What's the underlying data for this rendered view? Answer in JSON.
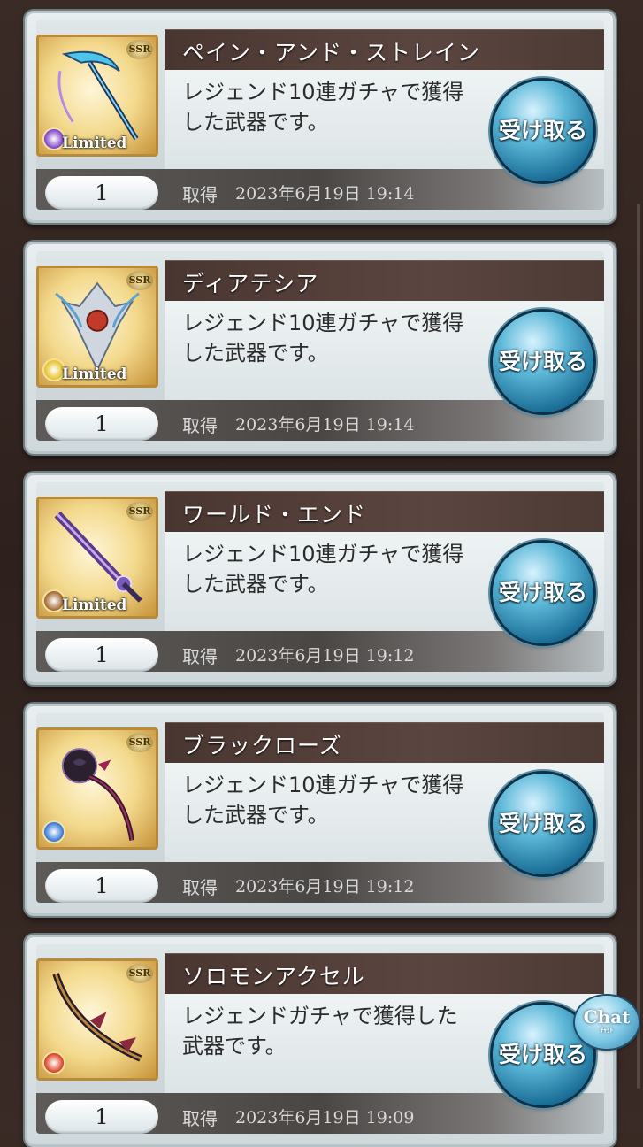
{
  "items": [
    {
      "title": "ペイン・アンド・ストレイン",
      "description": "レジェンド10連ガチャで獲得した武器です。",
      "quantity": "1",
      "acquired_label": "取得",
      "acquired_time": "2023年6月19日 19:14",
      "rarity": "SSR",
      "limited": "Limited",
      "element_color": "#7b3fc7",
      "weapon_icon": "scythe-icon",
      "button_label": "受け取る"
    },
    {
      "title": "ディアテシア",
      "description": "レジェンド10連ガチャで獲得した武器です。",
      "quantity": "1",
      "acquired_label": "取得",
      "acquired_time": "2023年6月19日 19:14",
      "rarity": "SSR",
      "limited": "Limited",
      "element_color": "#e6c020",
      "weapon_icon": "ornament-icon",
      "button_label": "受け取る"
    },
    {
      "title": "ワールド・エンド",
      "description": "レジェンド10連ガチャで獲得した武器です。",
      "quantity": "1",
      "acquired_label": "取得",
      "acquired_time": "2023年6月19日 19:12",
      "rarity": "SSR",
      "limited": "Limited",
      "element_color": "#a0622a",
      "weapon_icon": "sword-icon",
      "button_label": "受け取る"
    },
    {
      "title": "ブラックローズ",
      "description": "レジェンド10連ガチャで獲得した武器です。",
      "quantity": "1",
      "acquired_label": "取得",
      "acquired_time": "2023年6月19日 19:12",
      "rarity": "SSR",
      "limited": "",
      "element_color": "#2b73d8",
      "weapon_icon": "rose-whip-icon",
      "button_label": "受け取る"
    },
    {
      "title": "ソロモンアクセル",
      "description": "レジェンドガチャで獲得した武器です。",
      "quantity": "1",
      "acquired_label": "取得",
      "acquired_time": "2023年6月19日 19:09",
      "rarity": "SSR",
      "limited": "",
      "element_color": "#d83a1c",
      "weapon_icon": "bow-icon",
      "button_label": "受け取る"
    }
  ],
  "chat": {
    "label": "Chat",
    "sub": "ﾁｬｯﾄ"
  }
}
